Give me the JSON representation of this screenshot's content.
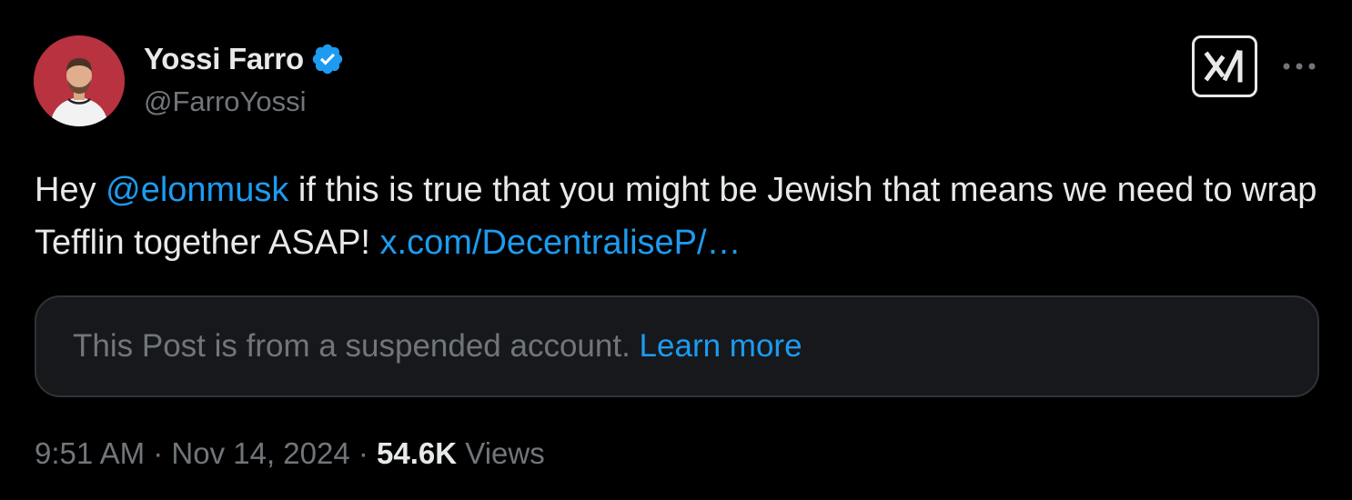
{
  "author": {
    "display_name": "Yossi Farro",
    "handle": "@FarroYossi",
    "verified": true,
    "badge_icon": "verified-badge-icon",
    "avatar_icon": "avatar"
  },
  "actions": {
    "grok_icon": "grok-icon",
    "more_icon": "more-dots-icon"
  },
  "tweet": {
    "text_prefix": "Hey ",
    "mention": "@elonmusk",
    "text_middle": " if this is true that you might be Jewish that means we need to wrap Tefflin together ASAP! ",
    "link": "x.com/DecentraliseP/…"
  },
  "notice": {
    "text": "This Post is from a suspended account. ",
    "link": "Learn more"
  },
  "meta": {
    "time": "9:51 AM",
    "separator": " · ",
    "date": "Nov 14, 2024",
    "views_count": "54.6K",
    "views_label": " Views"
  },
  "colors": {
    "background": "#000000",
    "accent": "#1d9bf0",
    "text": "#e7e9ea",
    "muted": "#71767b",
    "notice_bg": "#16181c",
    "avatar_bg": "#b8323f"
  }
}
